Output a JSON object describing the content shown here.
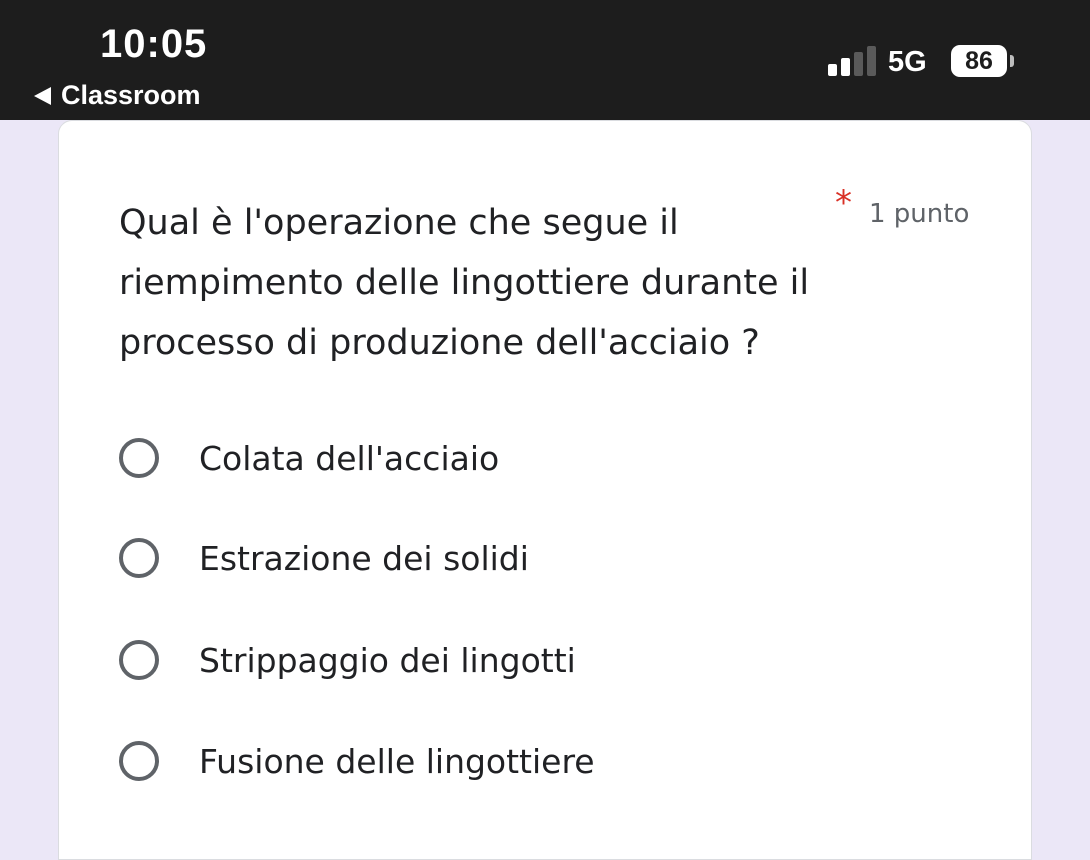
{
  "status_bar": {
    "time": "10:05",
    "network": "5G",
    "battery": "86",
    "back_label": "Classroom",
    "background_color": "#1d1d1d",
    "signal_icon": "signal-bars-icon",
    "signal_bars_active": 2,
    "signal_bars_total": 4
  },
  "form": {
    "question": "Qual è l'operazione che segue il riempimento delle lingottiere durante il processo di produzione dell'acciaio ?",
    "required_marker": "*",
    "points": "1 punto",
    "required_color": "#d93025",
    "page_background": "#ebe7f7",
    "options": [
      {
        "label": "Colata dell'acciaio",
        "selected": false
      },
      {
        "label": "Estrazione dei solidi",
        "selected": false
      },
      {
        "label": "Strippaggio dei lingotti",
        "selected": false
      },
      {
        "label": "Fusione delle lingottiere",
        "selected": false
      }
    ]
  }
}
